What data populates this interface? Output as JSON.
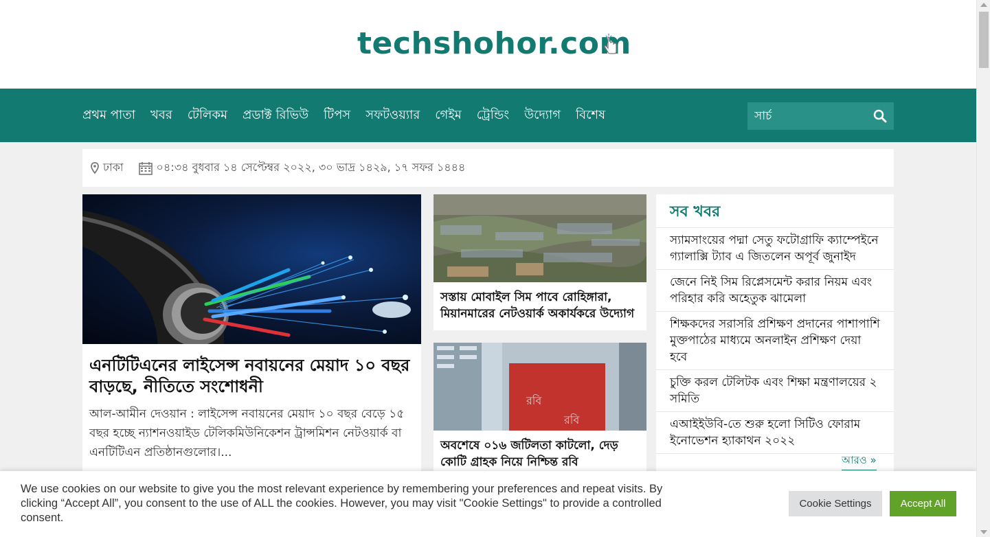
{
  "site": {
    "logo_text": "techshohor.com",
    "brand_color": "#137a72"
  },
  "nav": {
    "items": [
      "প্রথম পাতা",
      "খবর",
      "টেলিকম",
      "প্রডাক্ট রিভিউ",
      "টিপস",
      "সফটওয়্যার",
      "গেইম",
      "ট্রেন্ডিং",
      "উদ্যোগ",
      "বিশেষ"
    ],
    "search_placeholder": "সার্চ"
  },
  "infobar": {
    "location": "ঢাকা",
    "datetime": "০৪:৩৪ বুধবার ১৪ সেপ্টেম্বর ২০২২, ৩০ ভাদ্র ১৪২৯, ১৭ সফর ১৪৪৪"
  },
  "lead": {
    "title": "এনটিটিএনের লাইসেন্স নবায়নের মেয়াদ ১০ বছর বাড়ছে, নীতিতে সংশোধনী",
    "excerpt": "আল-আমীন দেওয়ান : লাইসেন্স নবায়নের মেয়াদ ১০ বছর বেড়ে ১৫ বছর হচ্ছে ন্যাশনওয়াইড টেলিকমিউনিকেশন ট্রান্সমিশন নেটওয়ার্ক বা এনটিটিএন প্রতিষ্ঠানগুলোর।..."
  },
  "cards": [
    {
      "title": "সস্তায় মোবাইল সিম পাবে রোহিঙ্গারা, মিয়ানমারের নেটওয়ার্ক অকার্যকরে উদ্যোগ"
    },
    {
      "title": "অবশেষে ০১৬ জটিলতা কাটলো, দেড় কোটি গ্রাহক নিয়ে নিশ্চিন্ত রবি"
    }
  ],
  "allnews": {
    "heading": "সব খবর",
    "items": [
      "স্যামসাংয়ের পদ্মা সেতু ফটোগ্রাফি ক্যাম্পেইনে গ্যালাক্সি ট্যাব এ জিতলেন অপূর্ব জুনাইদ",
      "জেনে নিই সিম রিপ্লেসমেন্ট করার নিয়ম এবং পরিহার করি অহেতুক ঝামেলা",
      "শিক্ষকদের সরাসরি প্রশিক্ষণ প্রদানের পাশাপাশি মুক্তপাঠের মাধ্যমে অনলাইন প্রশিক্ষণ দেয়া হবে",
      "চুক্তি করল টেলিটক এবং শিক্ষা মন্ত্রণালয়ের ২ সমিতি",
      "এআইইউবি-তে শুরু হলো সিটিও ফোরাম ইনোভেশন হ্যাকাথন ২০২২"
    ],
    "more_label": "আরও »"
  },
  "cookie": {
    "text": "We use cookies on our website to give you the most relevant experience by remembering your preferences and repeat visits. By clicking “Accept All”, you consent to the use of ALL the cookies. However, you may visit \"Cookie Settings\" to provide a controlled consent.",
    "settings_label": "Cookie Settings",
    "accept_label": "Accept All",
    "accept_color": "#61a229"
  }
}
